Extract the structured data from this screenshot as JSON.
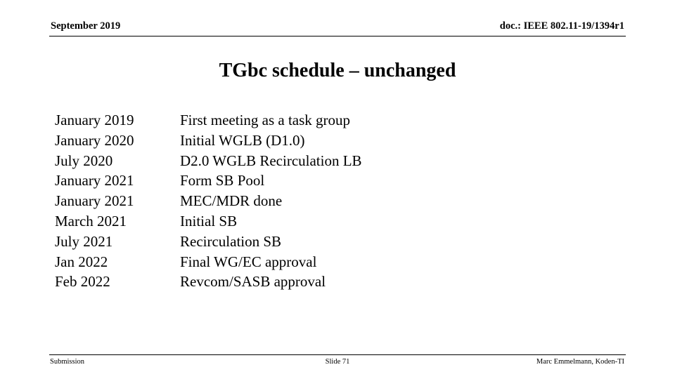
{
  "header": {
    "date": "September 2019",
    "doc": "doc.: IEEE 802.11-19/1394r1"
  },
  "title": "TGbc schedule – unchanged",
  "schedule": {
    "rows": [
      {
        "date": "January 2019",
        "milestone": "First meeting as a task group"
      },
      {
        "date": "January 2020",
        "milestone": "Initial WGLB (D1.0)"
      },
      {
        "date": "July 2020",
        "milestone": "D2.0 WGLB Recirculation LB"
      },
      {
        "date": "January 2021",
        "milestone": "Form SB Pool"
      },
      {
        "date": "January 2021",
        "milestone": "MEC/MDR done"
      },
      {
        "date": "March 2021",
        "milestone": "Initial SB"
      },
      {
        "date": "July 2021",
        "milestone": "Recirculation SB"
      },
      {
        "date": "Jan 2022",
        "milestone": "Final WG/EC approval"
      },
      {
        "date": "Feb 2022",
        "milestone": "Revcom/SASB approval"
      }
    ]
  },
  "footer": {
    "left": "Submission",
    "center": "Slide 71",
    "right": "Marc Emmelmann, Koden-TI"
  },
  "colors": {
    "background": "#ffffff",
    "text": "#000000",
    "rule": "#000000"
  }
}
